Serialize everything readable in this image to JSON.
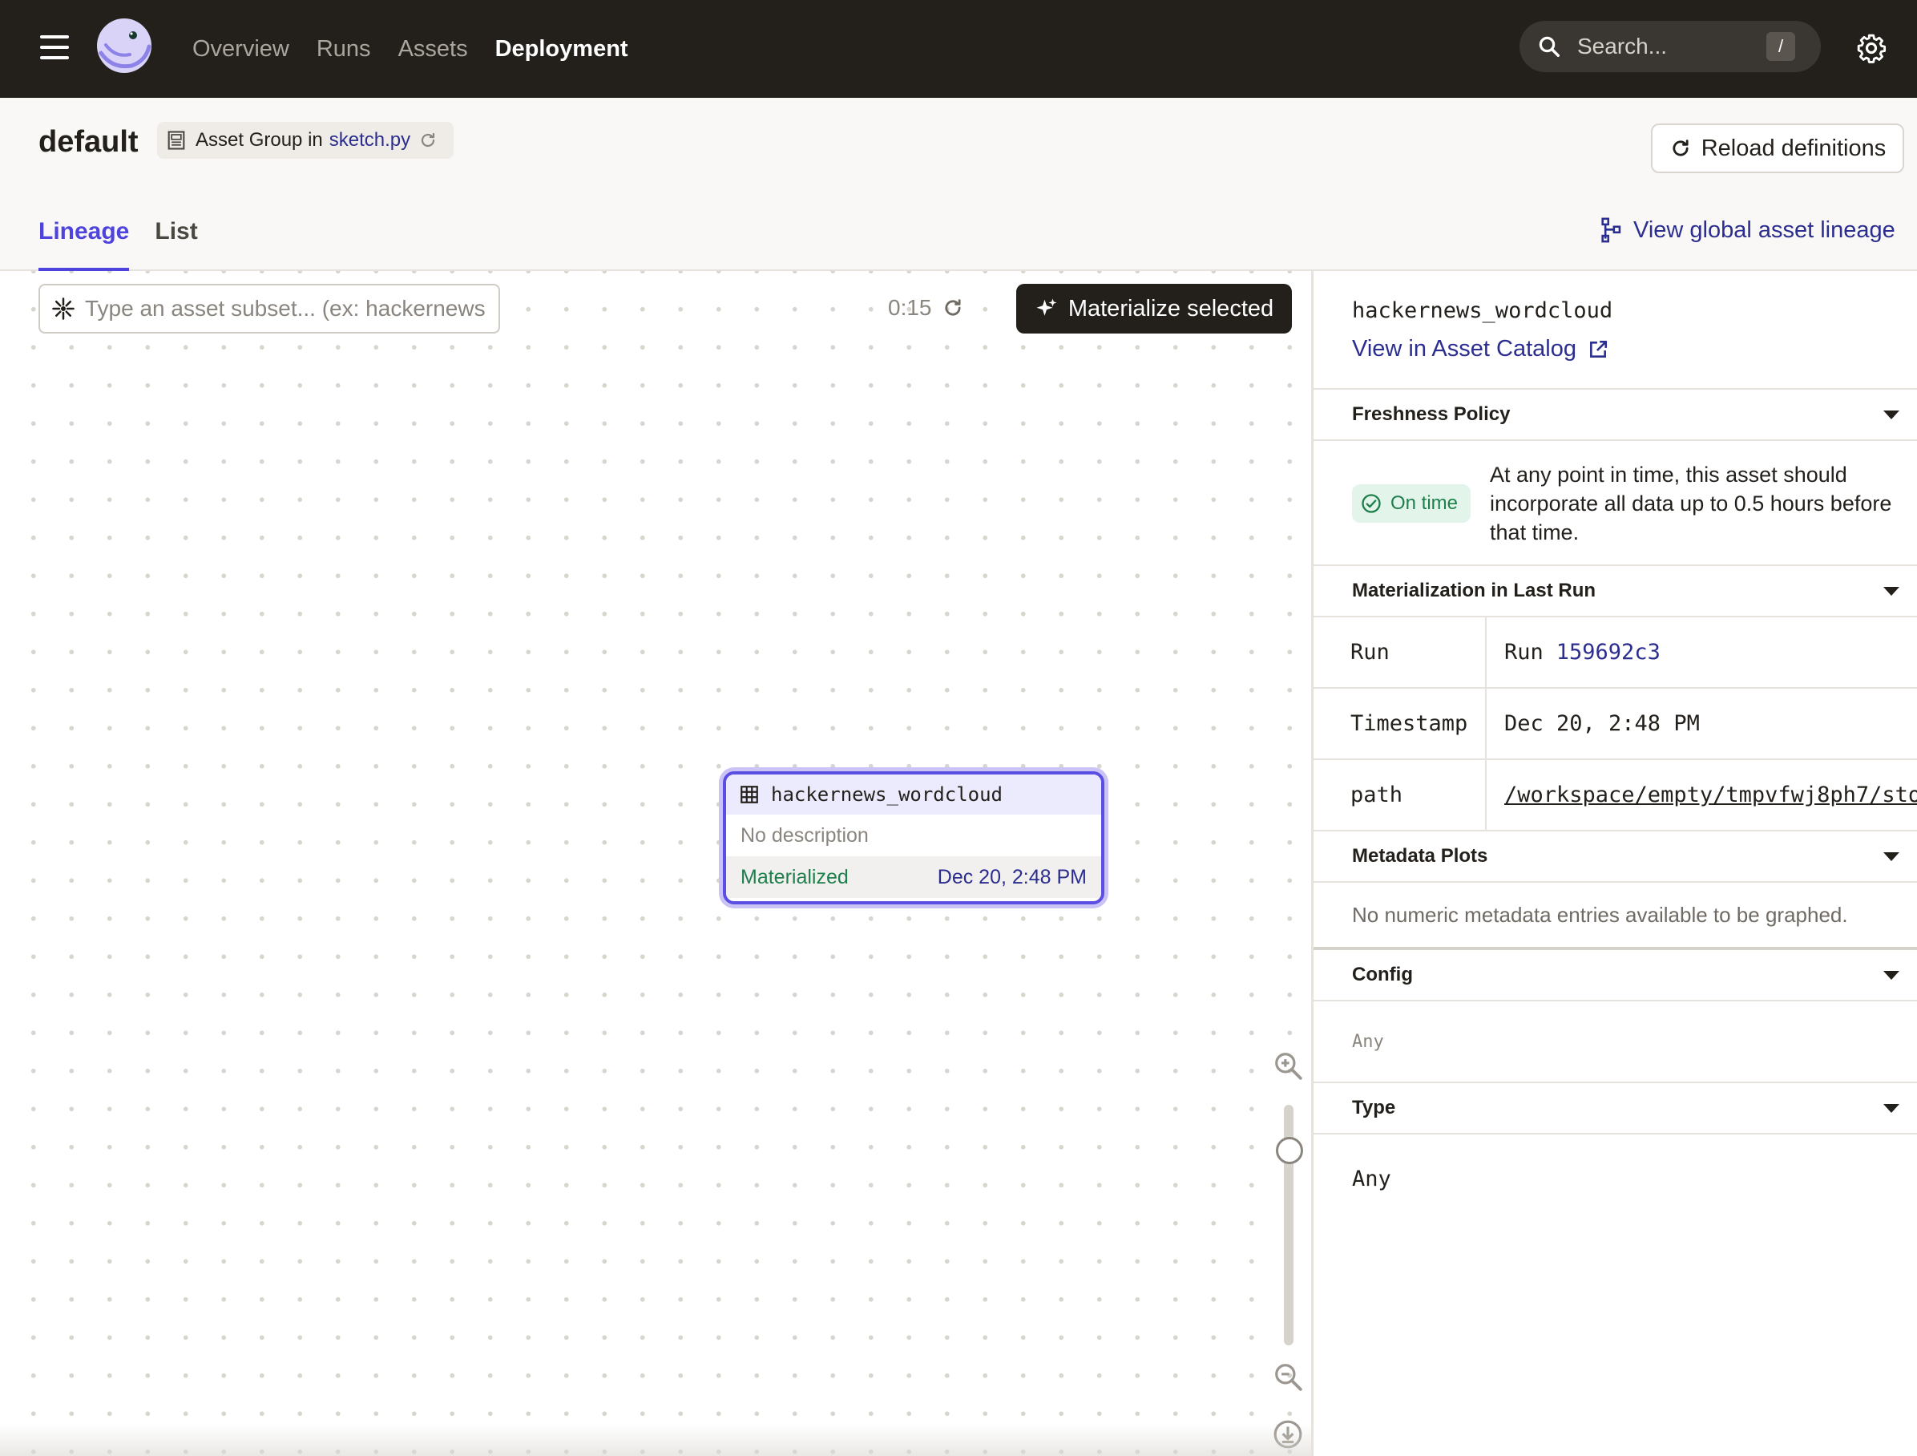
{
  "nav": {
    "links": [
      "Overview",
      "Runs",
      "Assets",
      "Deployment"
    ],
    "active": "Deployment",
    "search_placeholder": "Search...",
    "search_shortcut": "/"
  },
  "header": {
    "title": "default",
    "group_prefix": "Asset Group in",
    "group_location": "sketch.py",
    "reload_label": "Reload definitions",
    "tabs": [
      "Lineage",
      "List"
    ],
    "active_tab": "Lineage",
    "global_lineage_label": "View global asset lineage"
  },
  "graph": {
    "subset_placeholder": "Type an asset subset... (ex: hackernews",
    "refresh_timer": "0:15",
    "materialize_label": "Materialize selected",
    "node": {
      "name": "hackernews_wordcloud",
      "description": "No description",
      "status": "Materialized",
      "timestamp": "Dec 20, 2:48 PM"
    }
  },
  "sidebar": {
    "asset_name": "hackernews_wordcloud",
    "catalog_link": "View in Asset Catalog",
    "sections": {
      "freshness": "Freshness Policy",
      "last_run": "Materialization in Last Run",
      "plots": "Metadata Plots",
      "config": "Config",
      "type": "Type"
    },
    "freshness": {
      "badge": "On time",
      "text": "At any point in time, this asset should incorporate all data up to 0.5 hours before that time."
    },
    "materialization": {
      "run_key": "Run",
      "run_prefix": "Run",
      "run_id": "159692c3",
      "timestamp_key": "Timestamp",
      "timestamp_value": "Dec 20, 2:48 PM",
      "path_key": "path",
      "path_value": "/workspace/empty/tmpvfwj8ph7/sto"
    },
    "plots_empty": "No numeric metadata entries available to be graphed.",
    "config_value": "Any",
    "type_value": "Any"
  },
  "colors": {
    "nav_bg": "#231f1b",
    "accent": "#4f43dd",
    "link": "#2b2e8f",
    "success": "#1e7f4c"
  }
}
